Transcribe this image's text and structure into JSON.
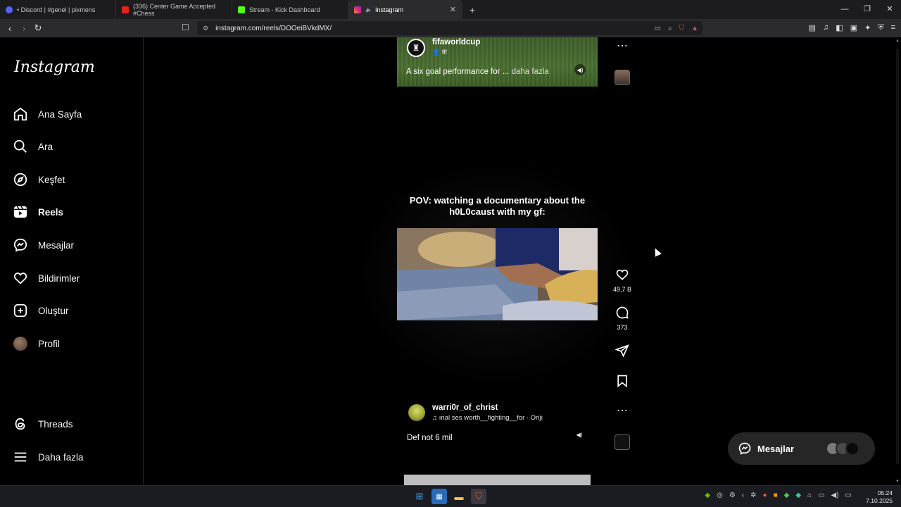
{
  "browser": {
    "tabs": [
      {
        "label": "• Discord | #genel | pixmens",
        "icon": "discord-icon"
      },
      {
        "label": "(336) Center Game Accepted #Chess",
        "icon": "youtube-icon"
      },
      {
        "label": "Stream - Kick Dashboard",
        "icon": "kick-icon"
      },
      {
        "label": "Instagram",
        "icon": "instagram-icon",
        "active": true
      }
    ],
    "new_tab_symbol": "+",
    "url": "instagram.com/reels/DOOeiBVkdMX/"
  },
  "sidebar": {
    "logo": "Instagram",
    "items": [
      {
        "label": "Ana Sayfa",
        "icon": "home-icon"
      },
      {
        "label": "Ara",
        "icon": "search-icon"
      },
      {
        "label": "Keşfet",
        "icon": "compass-icon"
      },
      {
        "label": "Reels",
        "icon": "reels-icon",
        "active": true
      },
      {
        "label": "Mesajlar",
        "icon": "messenger-icon"
      },
      {
        "label": "Bildirimler",
        "icon": "heart-icon"
      },
      {
        "label": "Oluştur",
        "icon": "plus-square-icon"
      },
      {
        "label": "Profil",
        "icon": "avatar"
      },
      {
        "label": "Threads",
        "icon": "threads-icon"
      },
      {
        "label": "Daha fazla",
        "icon": "menu-icon"
      }
    ]
  },
  "reel_prev": {
    "username": "fifaworldcup",
    "audio": "fff",
    "caption": "A six goal performance for ...",
    "more": "daha fazla"
  },
  "reel_current": {
    "overlay_text": "POV: watching a documentary about the h0L0caust with my gf:",
    "likes": "49,7 B",
    "comments": "373",
    "username": "warri0r_of_christ",
    "audio": "ınal ses    worth__fighting__for · Orijı",
    "caption": "Def not 6 mil"
  },
  "messages_button": {
    "label": "Mesajlar"
  },
  "taskbar": {
    "time": "05:24",
    "date": "7.10.2025"
  },
  "colors": {
    "bg": "#000000",
    "panel": "#262626",
    "accent": "#0095f6"
  }
}
